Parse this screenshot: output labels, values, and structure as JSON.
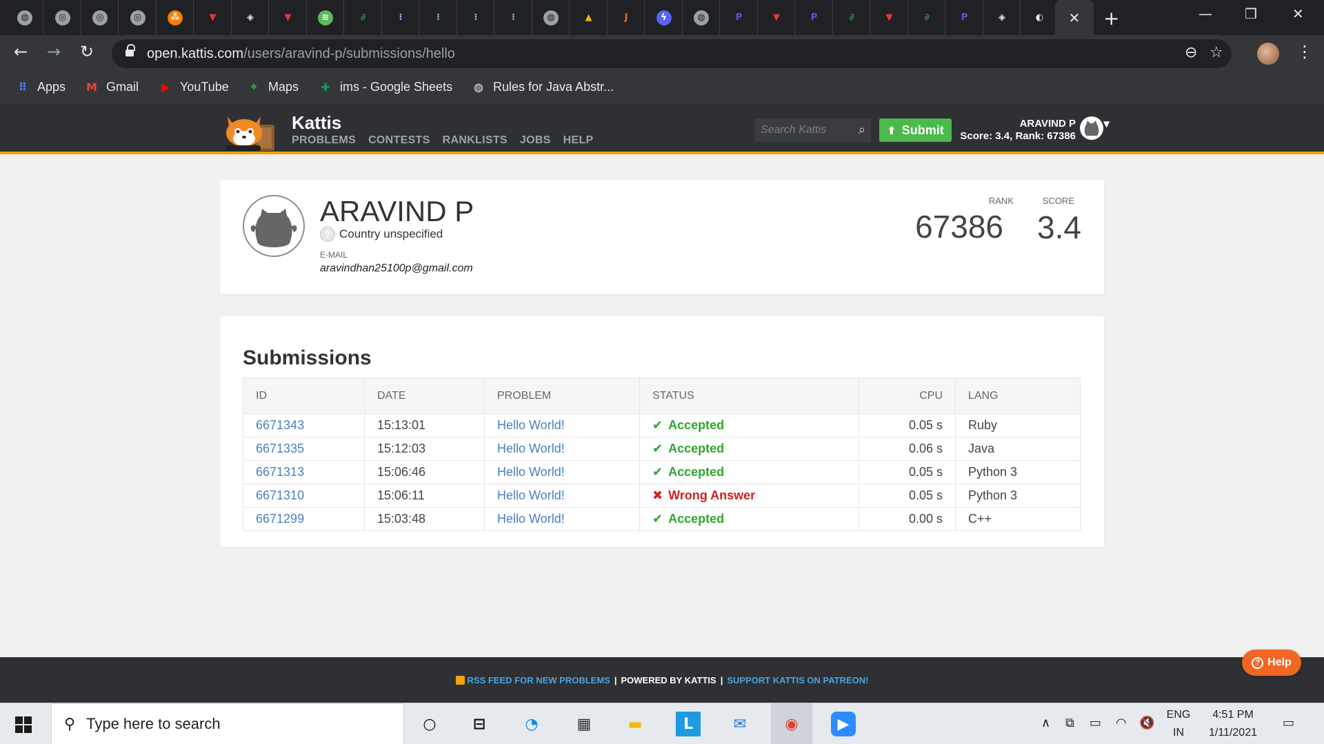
{
  "browser": {
    "tabs": [
      {
        "icon": "globe-icon",
        "glyph": "◍",
        "bg": "#9aa0a6",
        "fg": "#202124"
      },
      {
        "icon": "hackerrank-icon",
        "glyph": "◎",
        "bg": "#9aa0a6",
        "fg": "#202124"
      },
      {
        "icon": "hackerrank-icon",
        "glyph": "◎",
        "bg": "#9aa0a6",
        "fg": "#202124"
      },
      {
        "icon": "hackerrank-icon",
        "glyph": "◎",
        "bg": "#9aa0a6",
        "fg": "#202124"
      },
      {
        "icon": "orange-site-icon",
        "glyph": "⁂",
        "bg": "#f57c00",
        "fg": "#ffffff"
      },
      {
        "icon": "red-v-icon",
        "glyph": "▼",
        "bg": "transparent",
        "fg": "#e53935"
      },
      {
        "icon": "diamond-icon",
        "glyph": "◈",
        "bg": "transparent",
        "fg": "#e8eaed"
      },
      {
        "icon": "red-v-icon",
        "glyph": "▼",
        "bg": "transparent",
        "fg": "#e53935"
      },
      {
        "icon": "green-square-icon",
        "glyph": "≋",
        "bg": "#5cb85c",
        "fg": "#ffffff"
      },
      {
        "icon": "geeksforgeeks-icon",
        "glyph": "∂",
        "bg": "transparent",
        "fg": "#2f8d46"
      },
      {
        "icon": "bars-icon",
        "glyph": "⁝",
        "bg": "transparent",
        "fg": "#8ab4f8"
      },
      {
        "icon": "bars-icon",
        "glyph": "⁝",
        "bg": "transparent",
        "fg": "#8ab4f8"
      },
      {
        "icon": "bars-icon",
        "glyph": "⁝",
        "bg": "transparent",
        "fg": "#8ab4f8"
      },
      {
        "icon": "bars-icon",
        "glyph": "⁝",
        "bg": "transparent",
        "fg": "#8ab4f8"
      },
      {
        "icon": "globe-icon",
        "glyph": "◍",
        "bg": "#9aa0a6",
        "fg": "#202124"
      },
      {
        "icon": "pma-icon",
        "glyph": "▲",
        "bg": "transparent",
        "fg": "#f4b400"
      },
      {
        "icon": "j-icon",
        "glyph": "J",
        "bg": "transparent",
        "fg": "#e8711c"
      },
      {
        "icon": "bolt-icon",
        "glyph": "ϟ",
        "bg": "#5865f2",
        "fg": "#ffffff"
      },
      {
        "icon": "globe-icon",
        "glyph": "◍",
        "bg": "#9aa0a6",
        "fg": "#202124"
      },
      {
        "icon": "p-icon",
        "glyph": "P",
        "bg": "transparent",
        "fg": "#6b4ce6"
      },
      {
        "icon": "red-v-icon",
        "glyph": "▼",
        "bg": "transparent",
        "fg": "#e53935"
      },
      {
        "icon": "p-icon",
        "glyph": "P",
        "bg": "transparent",
        "fg": "#6b4ce6"
      },
      {
        "icon": "geeksforgeeks-icon",
        "glyph": "∂",
        "bg": "transparent",
        "fg": "#2f8d46"
      },
      {
        "icon": "red-v-icon",
        "glyph": "▼",
        "bg": "transparent",
        "fg": "#e53935"
      },
      {
        "icon": "geeksforgeeks-icon",
        "glyph": "∂",
        "bg": "transparent",
        "fg": "#2f8d46"
      },
      {
        "icon": "p-icon",
        "glyph": "P",
        "bg": "transparent",
        "fg": "#6b4ce6"
      },
      {
        "icon": "diamond-icon",
        "glyph": "◈",
        "bg": "transparent",
        "fg": "#e8eaed"
      },
      {
        "icon": "github-icon",
        "glyph": "◐",
        "bg": "transparent",
        "fg": "#e8eaed"
      }
    ],
    "active_tab_close": "✕",
    "new_tab": "+",
    "url_host": "open.kattis.com",
    "url_path": "/users/aravind-p/submissions/hello",
    "bookmarks": [
      {
        "label": "Apps",
        "icon": "apps-grid-icon",
        "glyph": "⠿",
        "color": "#4285f4"
      },
      {
        "label": "Gmail",
        "icon": "gmail-icon",
        "glyph": "M",
        "color": "#ea4335"
      },
      {
        "label": "YouTube",
        "icon": "youtube-icon",
        "glyph": "▶",
        "color": "#ff0000"
      },
      {
        "label": "Maps",
        "icon": "maps-icon",
        "glyph": "⌖",
        "color": "#34a853"
      },
      {
        "label": "ims - Google Sheets",
        "icon": "sheets-icon",
        "glyph": "✚",
        "color": "#0f9d58"
      },
      {
        "label": "Rules for Java Abstr...",
        "icon": "globe-icon",
        "glyph": "◍",
        "color": "#e8eaed"
      }
    ]
  },
  "site": {
    "brand": "Kattis",
    "nav": [
      "PROBLEMS",
      "CONTESTS",
      "RANKLISTS",
      "JOBS",
      "HELP"
    ],
    "search_placeholder": "Search Kattis",
    "submit_label": "Submit",
    "header_user": "ARAVIND P",
    "header_score": "Score: 3.4, Rank: 67386",
    "accent": "#f0a30a"
  },
  "profile": {
    "name": "ARAVIND P",
    "country": "Country unspecified",
    "email_label": "E-MAIL",
    "email": "aravindhan25100p@gmail.com",
    "rank_label": "RANK",
    "rank": "67386",
    "score_label": "SCORE",
    "score": "3.4"
  },
  "submissions": {
    "title": "Submissions",
    "columns": [
      "ID",
      "DATE",
      "PROBLEM",
      "STATUS",
      "CPU",
      "LANG"
    ],
    "rows": [
      {
        "id": "6671343",
        "date": "15:13:01",
        "problem": "Hello World!",
        "status": "Accepted",
        "ok": true,
        "cpu": "0.05 s",
        "lang": "Ruby"
      },
      {
        "id": "6671335",
        "date": "15:12:03",
        "problem": "Hello World!",
        "status": "Accepted",
        "ok": true,
        "cpu": "0.06 s",
        "lang": "Java"
      },
      {
        "id": "6671313",
        "date": "15:06:46",
        "problem": "Hello World!",
        "status": "Accepted",
        "ok": true,
        "cpu": "0.05 s",
        "lang": "Python 3"
      },
      {
        "id": "6671310",
        "date": "15:06:11",
        "problem": "Hello World!",
        "status": "Wrong Answer",
        "ok": false,
        "cpu": "0.05 s",
        "lang": "Python 3"
      },
      {
        "id": "6671299",
        "date": "15:03:48",
        "problem": "Hello World!",
        "status": "Accepted",
        "ok": true,
        "cpu": "0.00 s",
        "lang": "C++"
      }
    ]
  },
  "footer": {
    "rss": "RSS FEED FOR NEW PROBLEMS",
    "powered": "POWERED BY KATTIS",
    "patreon": "SUPPORT KATTIS ON PATREON!",
    "help": "Help"
  },
  "taskbar": {
    "search_placeholder": "Type here to search",
    "lang_top": "ENG",
    "lang_bottom": "IN",
    "time": "4:51 PM",
    "date": "1/11/2021"
  }
}
